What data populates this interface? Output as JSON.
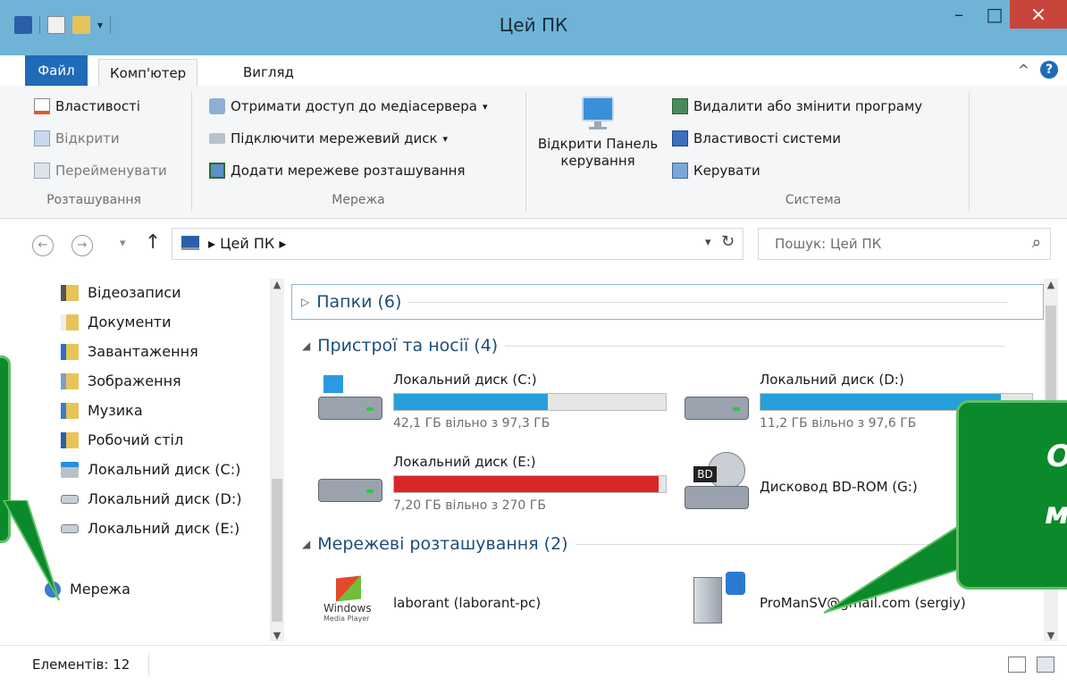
{
  "window": {
    "title": "Цей ПК",
    "min_glyph": "–",
    "max_glyph": "□",
    "close_glyph": "×"
  },
  "ribbon_tabs": {
    "file": "Файл",
    "computer": "Комп'ютер",
    "view": "Вигляд",
    "collapse_glyph": "^",
    "help_glyph": "?"
  },
  "ribbon": {
    "location": {
      "label": "Розташування",
      "properties": "Властивості",
      "open": "Відкрити",
      "rename": "Перейменувати"
    },
    "network": {
      "label": "Мережа",
      "media_server": "Отримати доступ до медіасервера",
      "map_drive": "Підключити мережевий диск",
      "add_location": "Додати мережеве розташування"
    },
    "control_panel": {
      "line1": "Відкрити Панель",
      "line2": "керування"
    },
    "system": {
      "label": "Система",
      "uninstall": "Видалити або змінити програму",
      "sys_props": "Властивості системи",
      "manage": "Керувати"
    }
  },
  "navigation": {
    "breadcrumb": "▸ Цей ПК ▸",
    "search_placeholder": "Пошук: Цей ПК"
  },
  "nav_pane": {
    "items": [
      {
        "label": "Відеозаписи",
        "icon": "video-folder-icon"
      },
      {
        "label": "Документи",
        "icon": "documents-folder-icon"
      },
      {
        "label": "Завантаження",
        "icon": "downloads-folder-icon"
      },
      {
        "label": "Зображення",
        "icon": "pictures-folder-icon"
      },
      {
        "label": "Музика",
        "icon": "music-folder-icon"
      },
      {
        "label": "Робочий стіл",
        "icon": "desktop-folder-icon"
      },
      {
        "label": "Локальний диск (C:)",
        "icon": "system-drive-icon"
      },
      {
        "label": "Локальний диск (D:)",
        "icon": "drive-icon"
      },
      {
        "label": "Локальний диск (E:)",
        "icon": "drive-icon"
      }
    ],
    "network": "Мережа"
  },
  "content": {
    "folders_group": "Папки (6)",
    "devices_group": "Пристрої та носії (4)",
    "network_group": "Мережеві розташування (2)",
    "drives": [
      {
        "name": "Локальний диск (C:)",
        "free_text": "42,1 ГБ вільно з 97,3 ГБ",
        "used_fraction": 0.567
      },
      {
        "name": "Локальний диск (D:)",
        "free_text": "11,2 ГБ вільно з 97,6 ГБ",
        "used_fraction": 0.885
      },
      {
        "name": "Локальний диск (E:)",
        "free_text": "7,20 ГБ вільно з 270 ГБ",
        "used_fraction": 0.973
      }
    ],
    "bd_drive": "Дисковод BD-ROM (G:)",
    "bd_badge": "BD",
    "network_locations": [
      {
        "name": "laborant (laborant-pc)"
      },
      {
        "name": "ProManSV@gmail.com (sergiy)"
      }
    ],
    "wmp_logo_line1": "Windows",
    "wmp_logo_line2": "Media Player"
  },
  "status": {
    "items": "Елементів: 12"
  },
  "callout": {
    "line1": "О",
    "line2": "м"
  },
  "colors": {
    "titlebar": "#6fb3d6",
    "file_tab": "#1e6bb8",
    "bar_fill": "#26a0da",
    "bar_full": "#da2626",
    "callout": "#0a8a2a"
  }
}
